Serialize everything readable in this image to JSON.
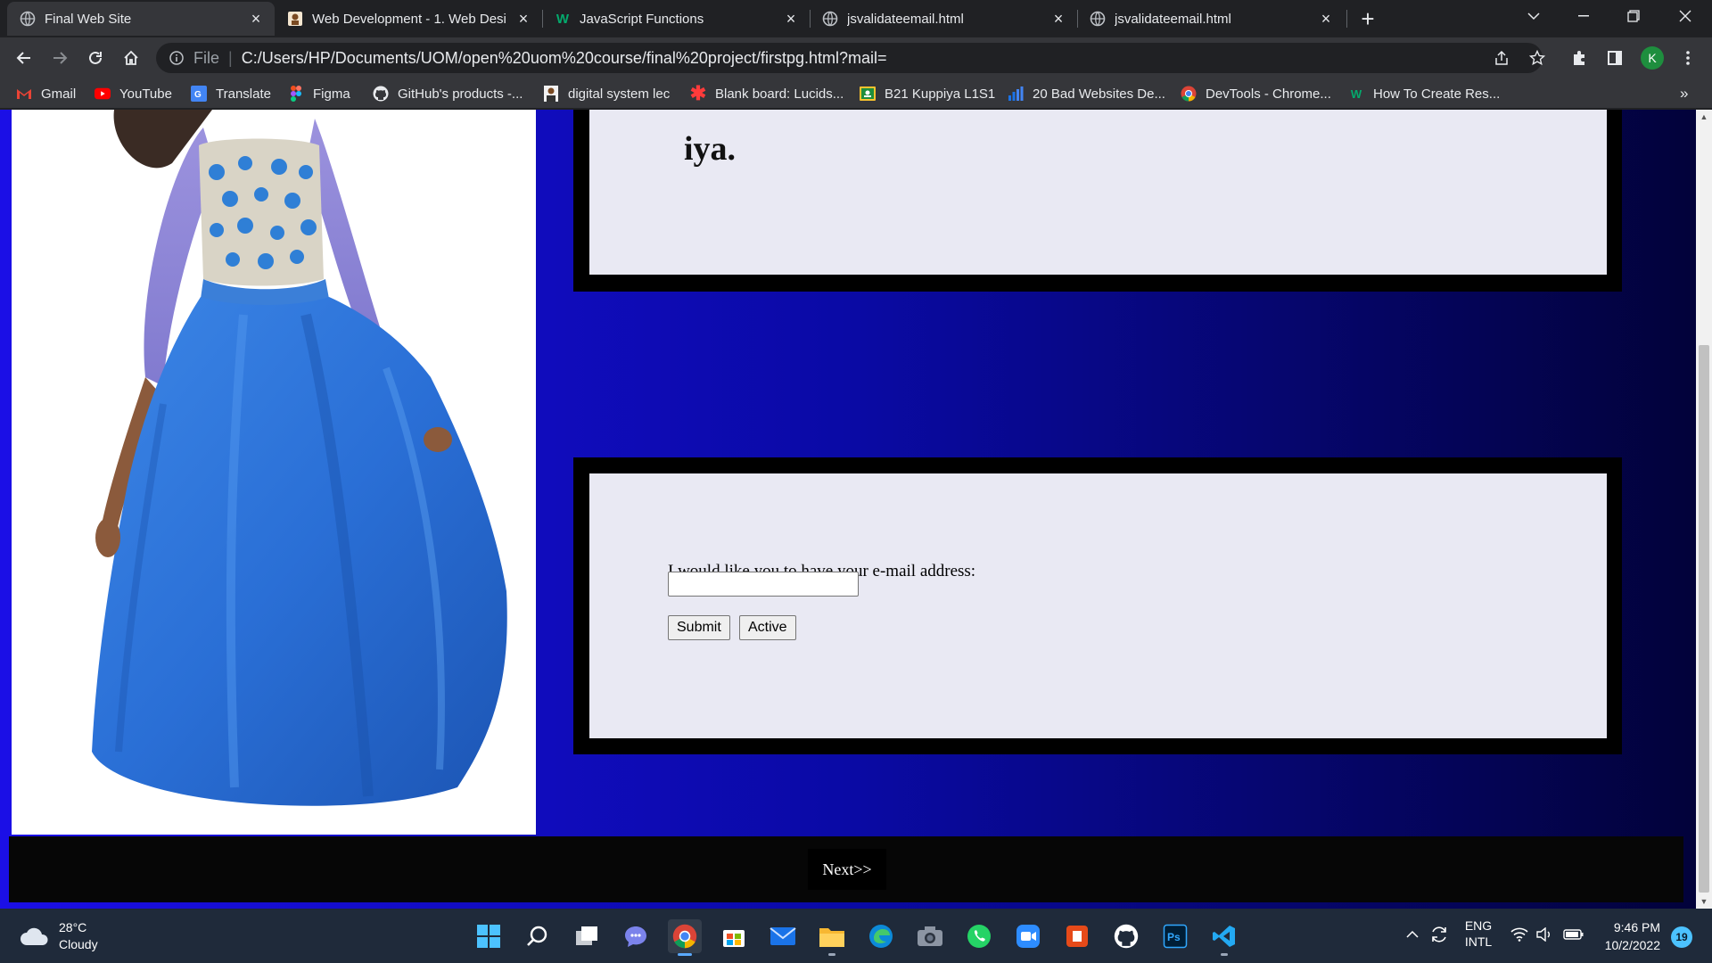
{
  "browser": {
    "tabs": [
      {
        "title": "Final Web Site"
      },
      {
        "title": "Web Development - 1. Web Desi"
      },
      {
        "title": "JavaScript Functions"
      },
      {
        "title": "jsvalidateemail.html"
      },
      {
        "title": "jsvalidateemail.html"
      }
    ],
    "new_tab_symbol": "+",
    "address": {
      "scheme": "File",
      "separator": "|",
      "url": "C:/Users/HP/Documents/UOM/open%20uom%20course/final%20project/firstpg.html?mail="
    },
    "profile_initial": "K",
    "bookmarks": [
      {
        "label": "Gmail",
        "icon": "gmail-icon"
      },
      {
        "label": "YouTube",
        "icon": "youtube-icon"
      },
      {
        "label": "Translate",
        "icon": "translate-icon"
      },
      {
        "label": "Figma",
        "icon": "figma-icon"
      },
      {
        "label": "GitHub's products -...",
        "icon": "github-icon"
      },
      {
        "label": "digital system lec",
        "icon": "avatar-icon"
      },
      {
        "label": "Blank board: Lucids...",
        "icon": "asterisk-icon"
      },
      {
        "label": "B21 Kuppiya L1S1",
        "icon": "classroom-icon"
      },
      {
        "label": "20 Bad Websites De...",
        "icon": "chart-icon"
      },
      {
        "label": "DevTools - Chrome...",
        "icon": "chrome-icon"
      },
      {
        "label": "How To Create Res...",
        "icon": "w3schools-icon"
      }
    ],
    "bookmarks_overflow": "»"
  },
  "page": {
    "top_card": {
      "heading": "iya."
    },
    "form": {
      "label": "I would like you to have your e-mail address:",
      "email_value": "",
      "submit_label": "Submit",
      "active_label": "Active"
    },
    "footer": {
      "next_label": "Next>>"
    }
  },
  "taskbar": {
    "weather": {
      "temp": "28°C",
      "condition": "Cloudy"
    },
    "language": {
      "line1": "ENG",
      "line2": "INTL"
    },
    "time": "9:46 PM",
    "date": "10/2/2022",
    "notifications": "19"
  },
  "colors": {
    "page_gradient_start": "#1b0fe6",
    "page_gradient_end": "#02023a",
    "card_background": "#e9e9f3",
    "dress_blue": "#2a6fd6"
  }
}
